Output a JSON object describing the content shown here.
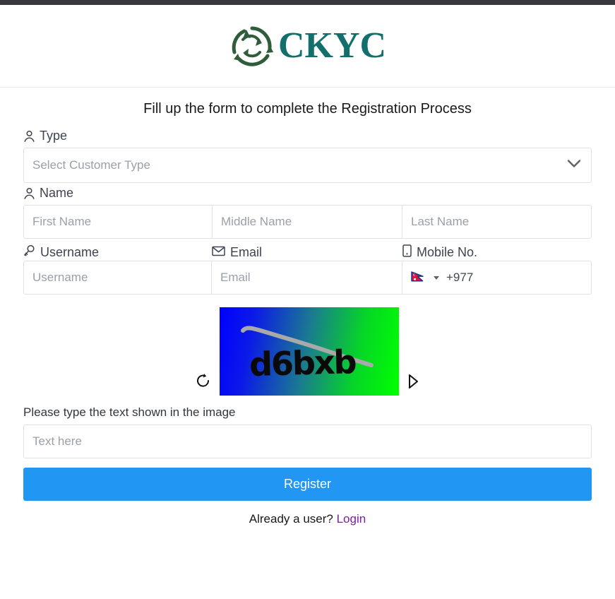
{
  "brand": {
    "name": "CKYC",
    "logo_icon": "circular-arrows-icon",
    "text_color": "#136f6b"
  },
  "form": {
    "title": "Fill up the form to complete the Registration Process",
    "type": {
      "label": "Type",
      "icon": "person-icon",
      "placeholder": "Select Customer Type",
      "value": "",
      "chevron_icon": "chevron-down-icon"
    },
    "name": {
      "label": "Name",
      "icon": "person-icon",
      "first_placeholder": "First Name",
      "middle_placeholder": "Middle Name",
      "last_placeholder": "Last Name",
      "first_value": "",
      "middle_value": "",
      "last_value": ""
    },
    "username": {
      "label": "Username",
      "icon": "key-icon",
      "placeholder": "Username",
      "value": ""
    },
    "email": {
      "label": "Email",
      "icon": "envelope-icon",
      "placeholder": "Email",
      "value": ""
    },
    "mobile": {
      "label": "Mobile No.",
      "icon": "mobile-phone-icon",
      "flag_icon": "nepal-flag-icon",
      "caret_icon": "caret-down-icon",
      "dial_code": "+977",
      "value": ""
    },
    "captcha": {
      "text": "d6bxb",
      "refresh_icon": "refresh-icon",
      "audio_icon": "play-icon",
      "prompt": "Please type the text shown in the image",
      "input_placeholder": "Text here",
      "input_value": "",
      "gradient_from": "#0000ff",
      "gradient_to": "#00ff00"
    },
    "submit_label": "Register",
    "submit_color": "#2196f3"
  },
  "footer": {
    "prompt": "Already a user?",
    "login_label": "Login",
    "login_color": "#7b1fa2"
  }
}
